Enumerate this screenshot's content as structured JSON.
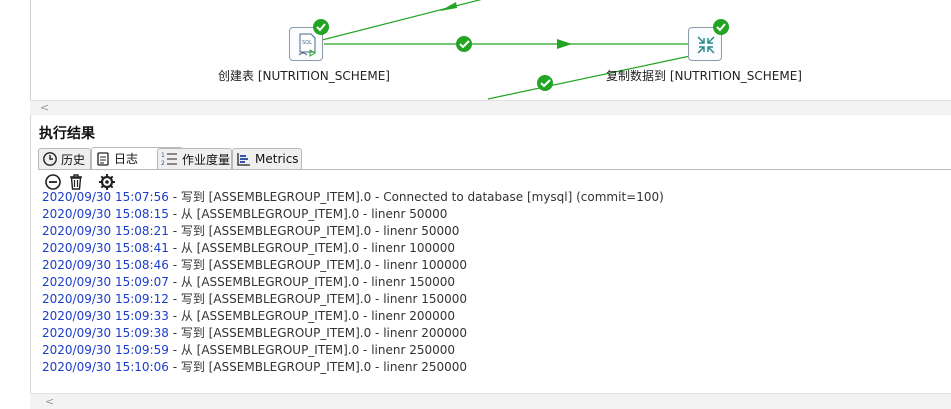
{
  "canvas": {
    "steps": [
      {
        "name": "创建表 [NUTRITION_SCHEME]",
        "icon": "sql-script-icon",
        "status": "success"
      },
      {
        "name": "复制数据到 [NUTRITION_SCHEME]",
        "icon": "table-output-icon",
        "status": "success"
      }
    ],
    "hop_color": "#23a423"
  },
  "results": {
    "title": "执行结果",
    "tabs": [
      {
        "label": "历史",
        "icon": "history-icon"
      },
      {
        "label": "日志",
        "icon": "log-icon",
        "active": true
      },
      {
        "label": "作业度量",
        "icon": "metrics-list-icon"
      },
      {
        "label": "Metrics",
        "icon": "metrics-chart-icon"
      }
    ],
    "toolbar": [
      {
        "name": "stop-icon",
        "title": "stop"
      },
      {
        "name": "trash-icon",
        "title": "clear"
      },
      {
        "name": "gear-icon",
        "title": "settings"
      }
    ],
    "log_lines": [
      {
        "ts": "2020/09/30 15:07:56",
        "msg": " - 写到 [ASSEMBLEGROUP_ITEM].0 - Connected to database [mysql] (commit=100)"
      },
      {
        "ts": "2020/09/30 15:08:15",
        "msg": " - 从 [ASSEMBLEGROUP_ITEM].0 - linenr 50000"
      },
      {
        "ts": "2020/09/30 15:08:21",
        "msg": " - 写到 [ASSEMBLEGROUP_ITEM].0 - linenr 50000"
      },
      {
        "ts": "2020/09/30 15:08:41",
        "msg": " - 从 [ASSEMBLEGROUP_ITEM].0 - linenr 100000"
      },
      {
        "ts": "2020/09/30 15:08:46",
        "msg": " - 写到 [ASSEMBLEGROUP_ITEM].0 - linenr 100000"
      },
      {
        "ts": "2020/09/30 15:09:07",
        "msg": " - 从 [ASSEMBLEGROUP_ITEM].0 - linenr 150000"
      },
      {
        "ts": "2020/09/30 15:09:12",
        "msg": " - 写到 [ASSEMBLEGROUP_ITEM].0 - linenr 150000"
      },
      {
        "ts": "2020/09/30 15:09:33",
        "msg": " - 从 [ASSEMBLEGROUP_ITEM].0 - linenr 200000"
      },
      {
        "ts": "2020/09/30 15:09:38",
        "msg": " - 写到 [ASSEMBLEGROUP_ITEM].0 - linenr 200000"
      },
      {
        "ts": "2020/09/30 15:09:59",
        "msg": " - 从 [ASSEMBLEGROUP_ITEM].0 - linenr 250000"
      },
      {
        "ts": "2020/09/30 15:10:06",
        "msg": " - 写到 [ASSEMBLEGROUP_ITEM].0 - linenr 250000"
      }
    ],
    "ts_color": "#1c3ccc"
  }
}
